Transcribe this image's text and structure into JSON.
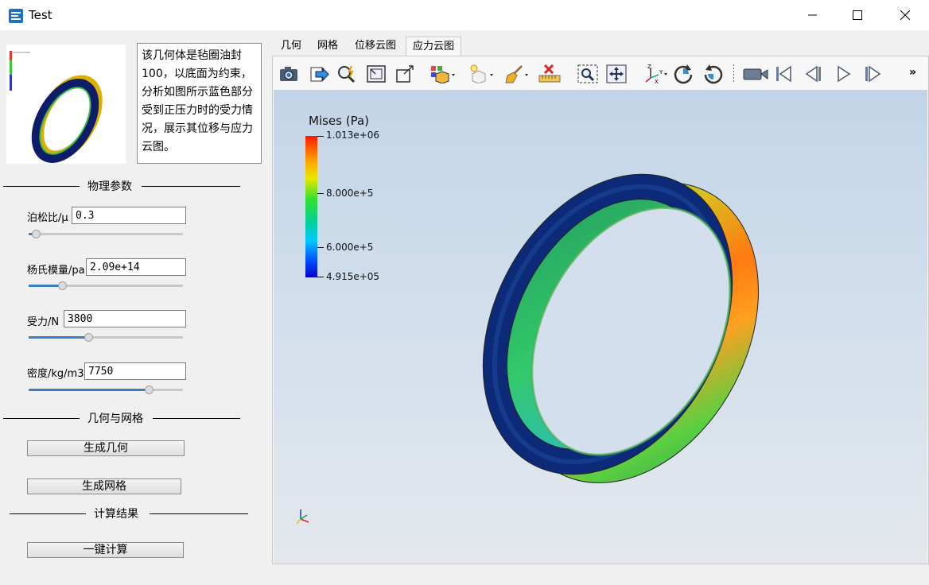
{
  "window": {
    "title": "Test"
  },
  "description": "该几何体是毡圈油封100，以底面为约束，分析如图所示蓝色部分受到正压力时的受力情况，展示其位移与应力云图。",
  "sections": {
    "physics": "物理参数",
    "geometry_mesh": "几何与网格",
    "results": "计算结果"
  },
  "params": {
    "poisson": {
      "label": "泊松比/μ",
      "value": "0.3",
      "slider": 0.02
    },
    "youngs": {
      "label": "杨氏模量/pa",
      "value": "2.09e+14",
      "slider": 0.2
    },
    "force": {
      "label": "受力/N",
      "value": "3800",
      "slider": 0.38
    },
    "density": {
      "label": "密度/kg/m3",
      "value": "7750",
      "slider": 0.8
    }
  },
  "buttons": {
    "gen_geometry": "生成几何",
    "gen_mesh": "生成网格",
    "compute": "一键计算"
  },
  "tabs": [
    "几何",
    "网格",
    "位移云图",
    "应力云图"
  ],
  "active_tab": 3,
  "toolbar": {
    "icons": [
      "camera-icon",
      "export-icon",
      "pick-icon",
      "view-fit-icon",
      "view-box-icon",
      "layers-icon",
      "material-icon",
      "clean-icon",
      "ruler-icon",
      "zoom-box-icon",
      "pan-icon",
      "axes-icon",
      "rotate-cw-icon",
      "rotate-ccw-icon",
      "record-icon",
      "first-frame-icon",
      "prev-frame-icon",
      "play-icon",
      "last-frame-icon"
    ],
    "overflow": "»"
  },
  "colorbar": {
    "title": "Mises (Pa)",
    "max": "1.013e+06",
    "tick1": "8.000e+5",
    "tick2": "6.000e+5",
    "min": "4.915e+05",
    "max_value": 1013000,
    "min_value": 491500
  }
}
